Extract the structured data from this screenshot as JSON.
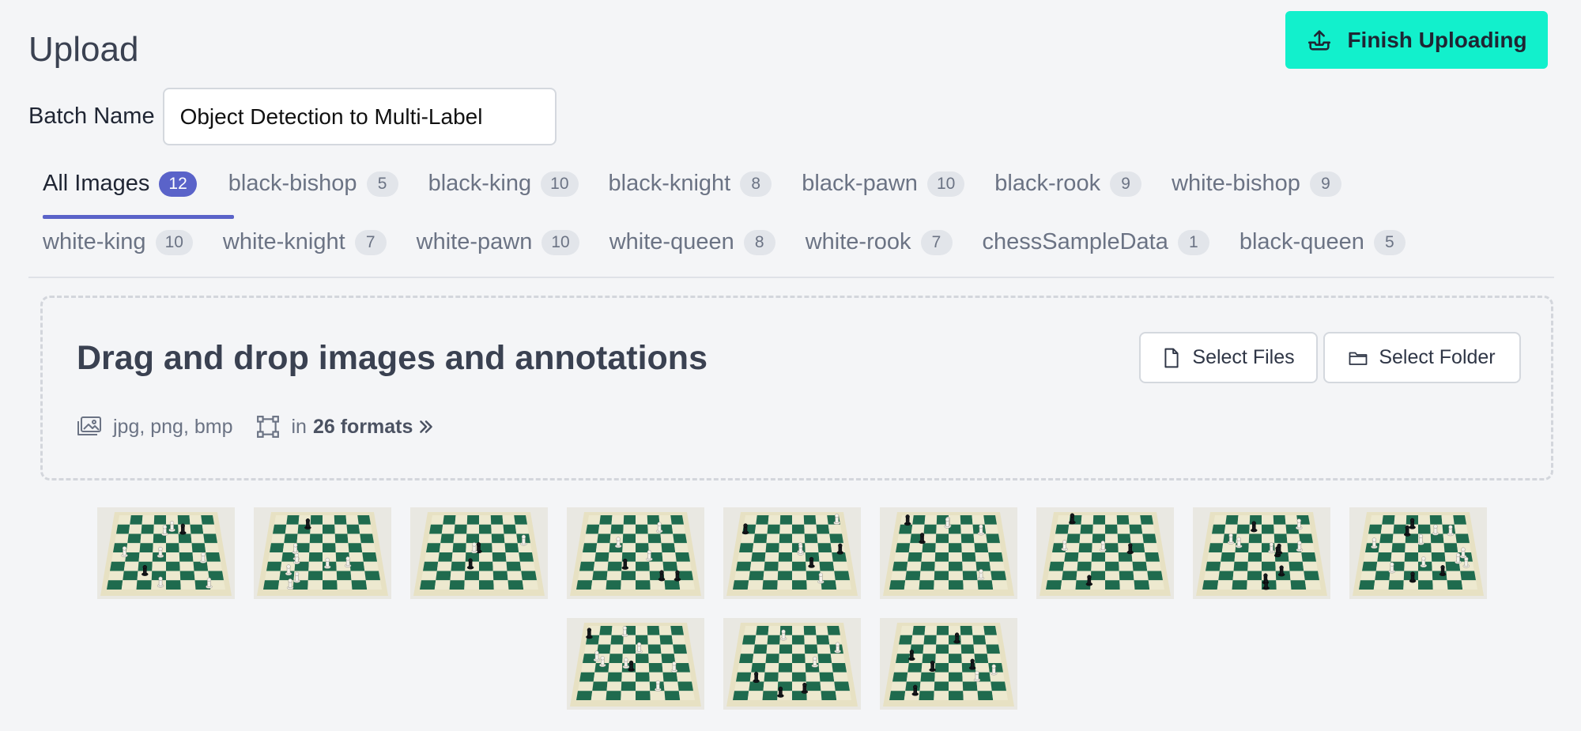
{
  "header": {
    "title": "Upload",
    "finish_label": "Finish Uploading"
  },
  "batch": {
    "label": "Batch Name",
    "value": "Object Detection to Multi-Label"
  },
  "tabs": [
    {
      "label": "All Images",
      "count": "12"
    },
    {
      "label": "black-bishop",
      "count": "5"
    },
    {
      "label": "black-king",
      "count": "10"
    },
    {
      "label": "black-knight",
      "count": "8"
    },
    {
      "label": "black-pawn",
      "count": "10"
    },
    {
      "label": "black-rook",
      "count": "9"
    },
    {
      "label": "white-bishop",
      "count": "9"
    },
    {
      "label": "white-king",
      "count": "10"
    },
    {
      "label": "white-knight",
      "count": "7"
    },
    {
      "label": "white-pawn",
      "count": "10"
    },
    {
      "label": "white-queen",
      "count": "8"
    },
    {
      "label": "white-rook",
      "count": "7"
    },
    {
      "label": "chessSampleData",
      "count": "1"
    },
    {
      "label": "black-queen",
      "count": "5"
    }
  ],
  "dropzone": {
    "title": "Drag and drop images and annotations",
    "select_files": "Select Files",
    "select_folder": "Select Folder",
    "image_types": "jpg, png, bmp",
    "formats_prefix": "in",
    "formats_count": "26 formats"
  },
  "colors": {
    "accent": "#12f0cc",
    "tab_active": "#5a63c9",
    "board_dark": "#1f6b4e",
    "board_light": "#ede9cf"
  },
  "icons": {
    "finish": "upload-cloud-icon",
    "files": "file-icon",
    "folder": "folder-icon",
    "images": "images-icon",
    "formats": "bounding-box-icon",
    "more": "double-chevron-right-icon"
  },
  "thumbnails": [
    {
      "name": "chessboard-image-1"
    },
    {
      "name": "chessboard-image-2"
    },
    {
      "name": "chessboard-image-3"
    },
    {
      "name": "chessboard-image-4"
    },
    {
      "name": "chessboard-image-5"
    },
    {
      "name": "chessboard-image-6"
    },
    {
      "name": "chessboard-image-7"
    },
    {
      "name": "chessboard-image-8"
    },
    {
      "name": "chessboard-image-9"
    },
    {
      "name": "chessboard-image-10"
    },
    {
      "name": "chessboard-image-11"
    },
    {
      "name": "chessboard-image-12"
    }
  ]
}
